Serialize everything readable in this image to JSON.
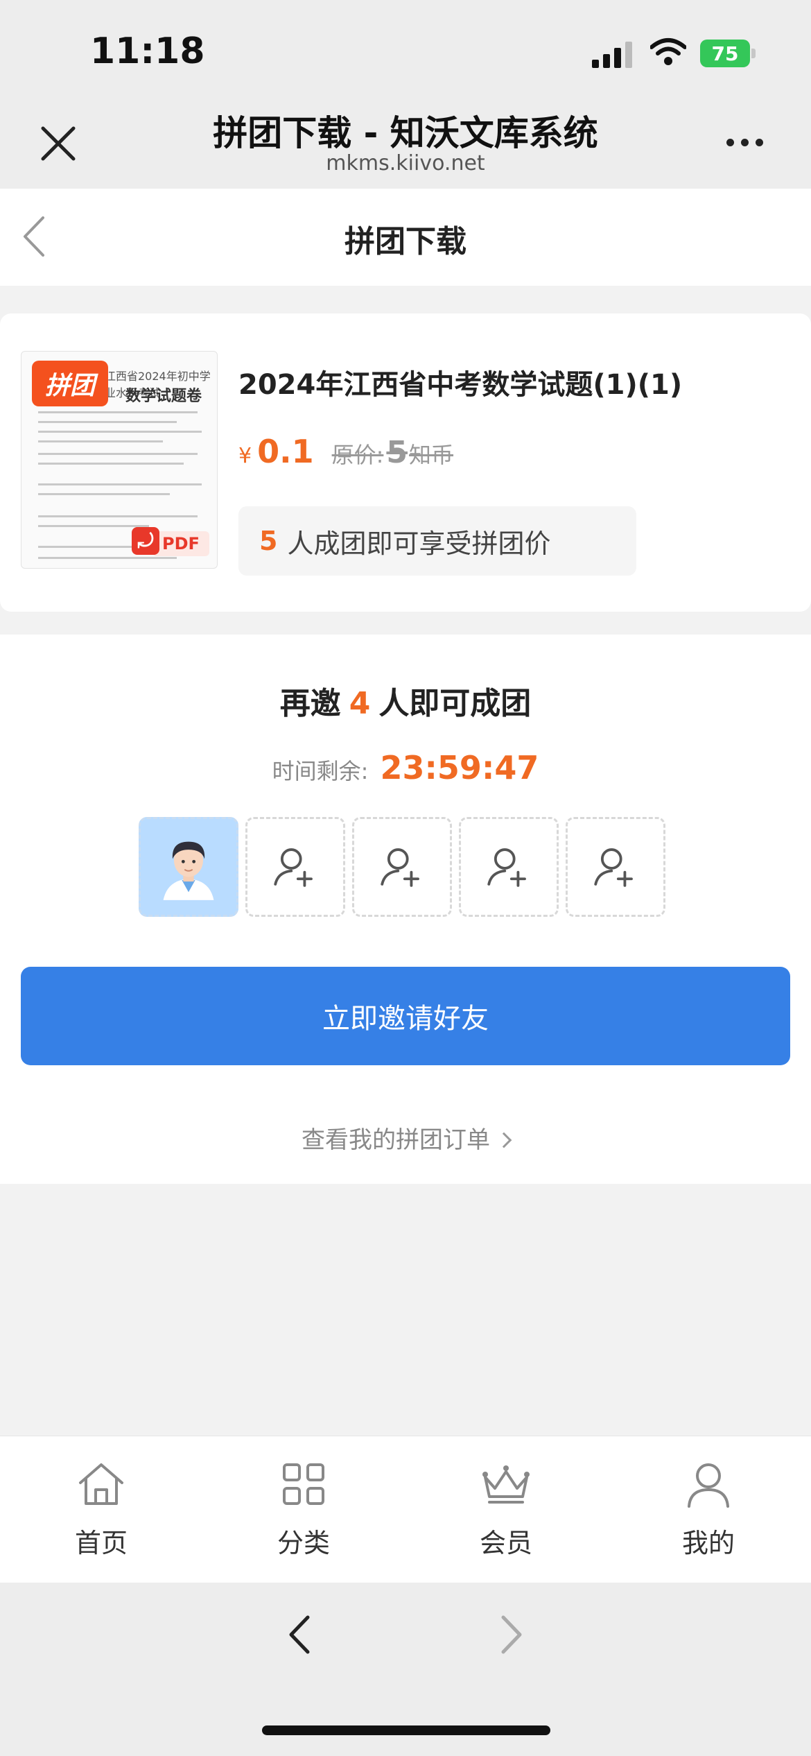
{
  "status_bar": {
    "time": "11:18",
    "battery": "75"
  },
  "browser": {
    "title": "拼团下载 - 知沃文库系统",
    "url": "mkms.kiivo.net"
  },
  "header": {
    "title": "拼团下载"
  },
  "product": {
    "badge": "拼团",
    "thumb_head": "江西省2024年初中学业水平考试",
    "thumb_title": "数学试题卷",
    "pdf_label": "PDF",
    "name": "2024年江西省中考数学试题(1)(1)",
    "price_currency": "¥",
    "price": "0.1",
    "original_label": "原价:",
    "original_value": "5",
    "original_unit": "知币",
    "group_size": "5",
    "group_hint": "人成团即可享受拼团价"
  },
  "invite": {
    "prefix": "再邀",
    "remaining": "4",
    "suffix": "人即可成团",
    "timer_label": "时间剩余:",
    "timer_value": "23:59:47",
    "button_label": "立即邀请好友",
    "orders_link": "查看我的拼团订单"
  },
  "bottom_nav": {
    "items": [
      {
        "label": "首页",
        "icon": "home-icon"
      },
      {
        "label": "分类",
        "icon": "grid-icon"
      },
      {
        "label": "会员",
        "icon": "crown-icon"
      },
      {
        "label": "我的",
        "icon": "user-icon"
      }
    ]
  },
  "colors": {
    "accent": "#f06a23",
    "primary_button": "#3680e6",
    "battery": "#34c759"
  }
}
